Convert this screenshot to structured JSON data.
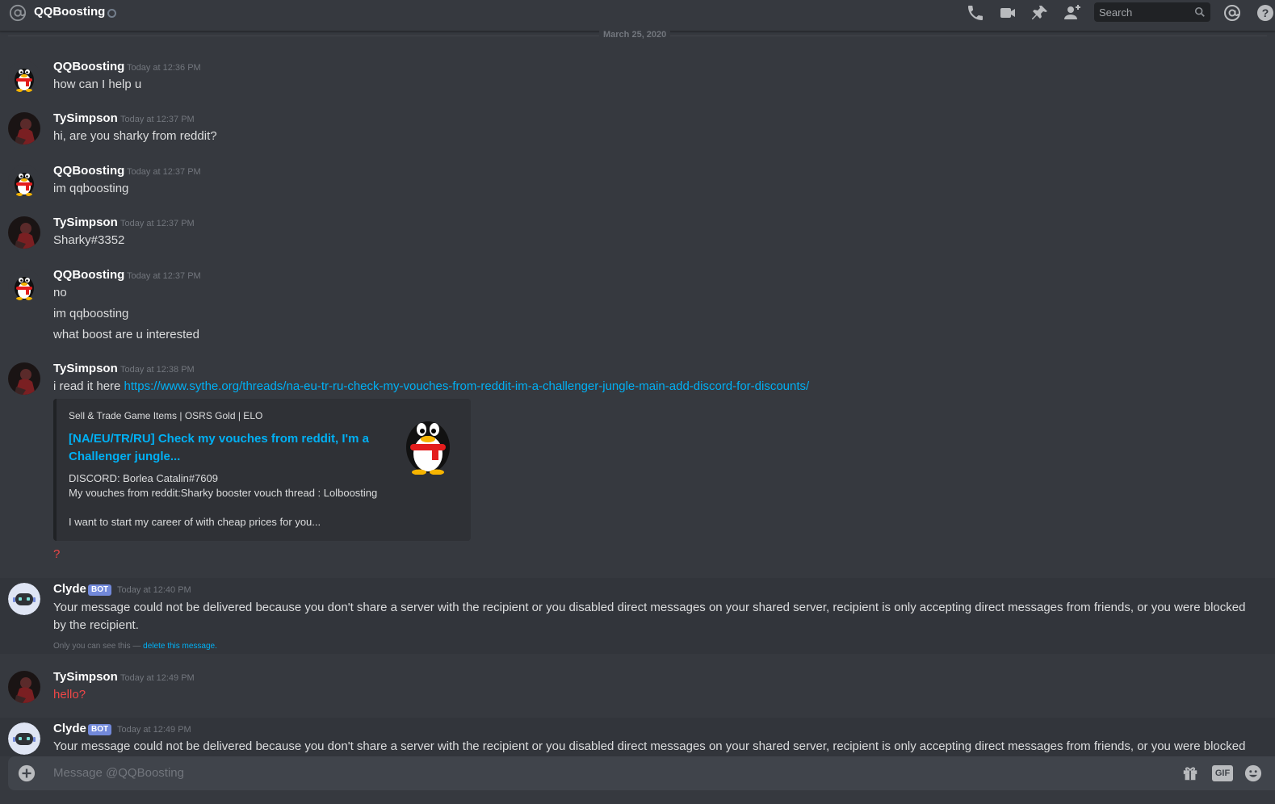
{
  "header": {
    "channel_name": "QQBoosting",
    "search_placeholder": "Search",
    "icons": [
      "at-icon",
      "call-icon",
      "video-icon",
      "pin-icon",
      "add-friend-icon",
      "search-icon",
      "mention-icon",
      "help-icon"
    ]
  },
  "date_divider": "March 25, 2020",
  "messages": [
    {
      "author": "QQBoosting",
      "timestamp": "Today at 12:36 PM",
      "lines": [
        "how can I help u"
      ]
    },
    {
      "author": "TySimpson",
      "timestamp": "Today at 12:37 PM",
      "lines": [
        "hi, are you sharky from reddit?"
      ]
    },
    {
      "author": "QQBoosting",
      "timestamp": "Today at 12:37 PM",
      "lines": [
        "im qqboosting"
      ]
    },
    {
      "author": "TySimpson",
      "timestamp": "Today at 12:37 PM",
      "lines": [
        "Sharky#3352"
      ]
    },
    {
      "author": "QQBoosting",
      "timestamp": "Today at 12:37 PM",
      "lines": [
        "no",
        "im qqboosting",
        "what boost are u interested"
      ]
    },
    {
      "author": "TySimpson",
      "timestamp": "Today at 12:38 PM",
      "text_prefix": "i read it here ",
      "link": "https://www.sythe.org/threads/na-eu-tr-ru-check-my-vouches-from-reddit-im-a-challenger-jungle-main-add-discord-for-discounts/",
      "failed_line": "?"
    },
    {
      "author": "Clyde",
      "bot_tag": "BOT",
      "timestamp": "Today at 12:40 PM",
      "lines": [
        "Your message could not be delivered because you don't share a server with the recipient or you disabled direct messages on your shared server, recipient is only accepting direct messages from friends, or you were blocked",
        "by the recipient."
      ],
      "ephemeral_note": "Only you can see this —",
      "delete_link": "delete this message."
    },
    {
      "author": "TySimpson",
      "timestamp": "Today at 12:49 PM",
      "failed_line": "hello?"
    },
    {
      "author": "Clyde",
      "bot_tag": "BOT",
      "timestamp": "Today at 12:49 PM",
      "lines": [
        "Your message could not be delivered because you don't share a server with the recipient or you disabled direct messages on your shared server, recipient is only accepting direct messages from friends, or you were blocked"
      ]
    }
  ],
  "embed": {
    "provider": "Sell & Trade Game Items | OSRS Gold | ELO",
    "title_line1": "[NA/EU/TR/RU] Check my vouches from reddit, I'm a",
    "title_line2": "Challenger jungle...",
    "desc_lines": [
      "DISCORD: Borlea Catalin#7609",
      "My vouches from reddit:Sharky booster vouch thread : Lolboosting",
      "I want to start my career of with cheap prices for you..."
    ]
  },
  "composer": {
    "placeholder": "Message @QQBoosting",
    "icons": [
      "plus-icon",
      "gift-icon",
      "gif-icon",
      "emoji-icon"
    ],
    "gif_label": "GIF"
  },
  "colors": {
    "background": "#36393f",
    "link": "#00b0f4",
    "error": "#f04747",
    "bot_tag": "#7289da"
  }
}
